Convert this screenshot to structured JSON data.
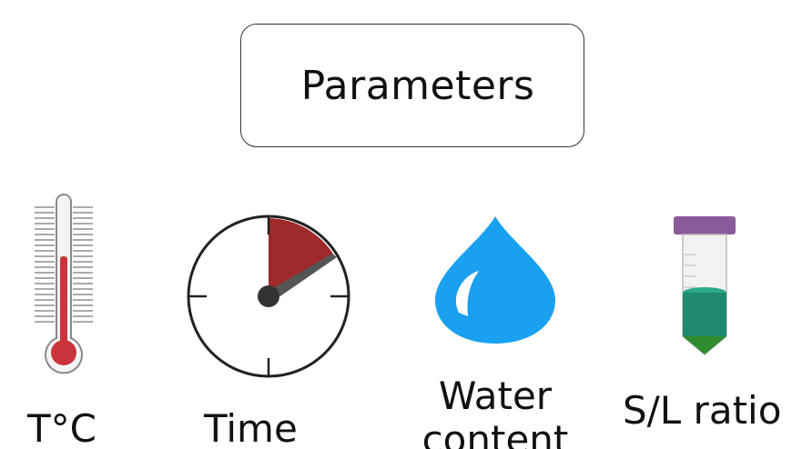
{
  "title": "Parameters",
  "parameters": [
    {
      "label": "T°C",
      "icon": "thermometer-icon"
    },
    {
      "label": "Time",
      "icon": "timer-icon"
    },
    {
      "label": "Water content",
      "icon": "water-drop-icon"
    },
    {
      "label": "S/L ratio",
      "icon": "test-tube-icon"
    }
  ],
  "colors": {
    "thermometer_fill": "#c8343a",
    "timer_sector": "#9e2a2b",
    "water": "#1aa0f0",
    "tube_cap": "#8a5a9a",
    "tube_liquid": "#1f8a70",
    "tube_bottom": "#2e8b2e"
  }
}
